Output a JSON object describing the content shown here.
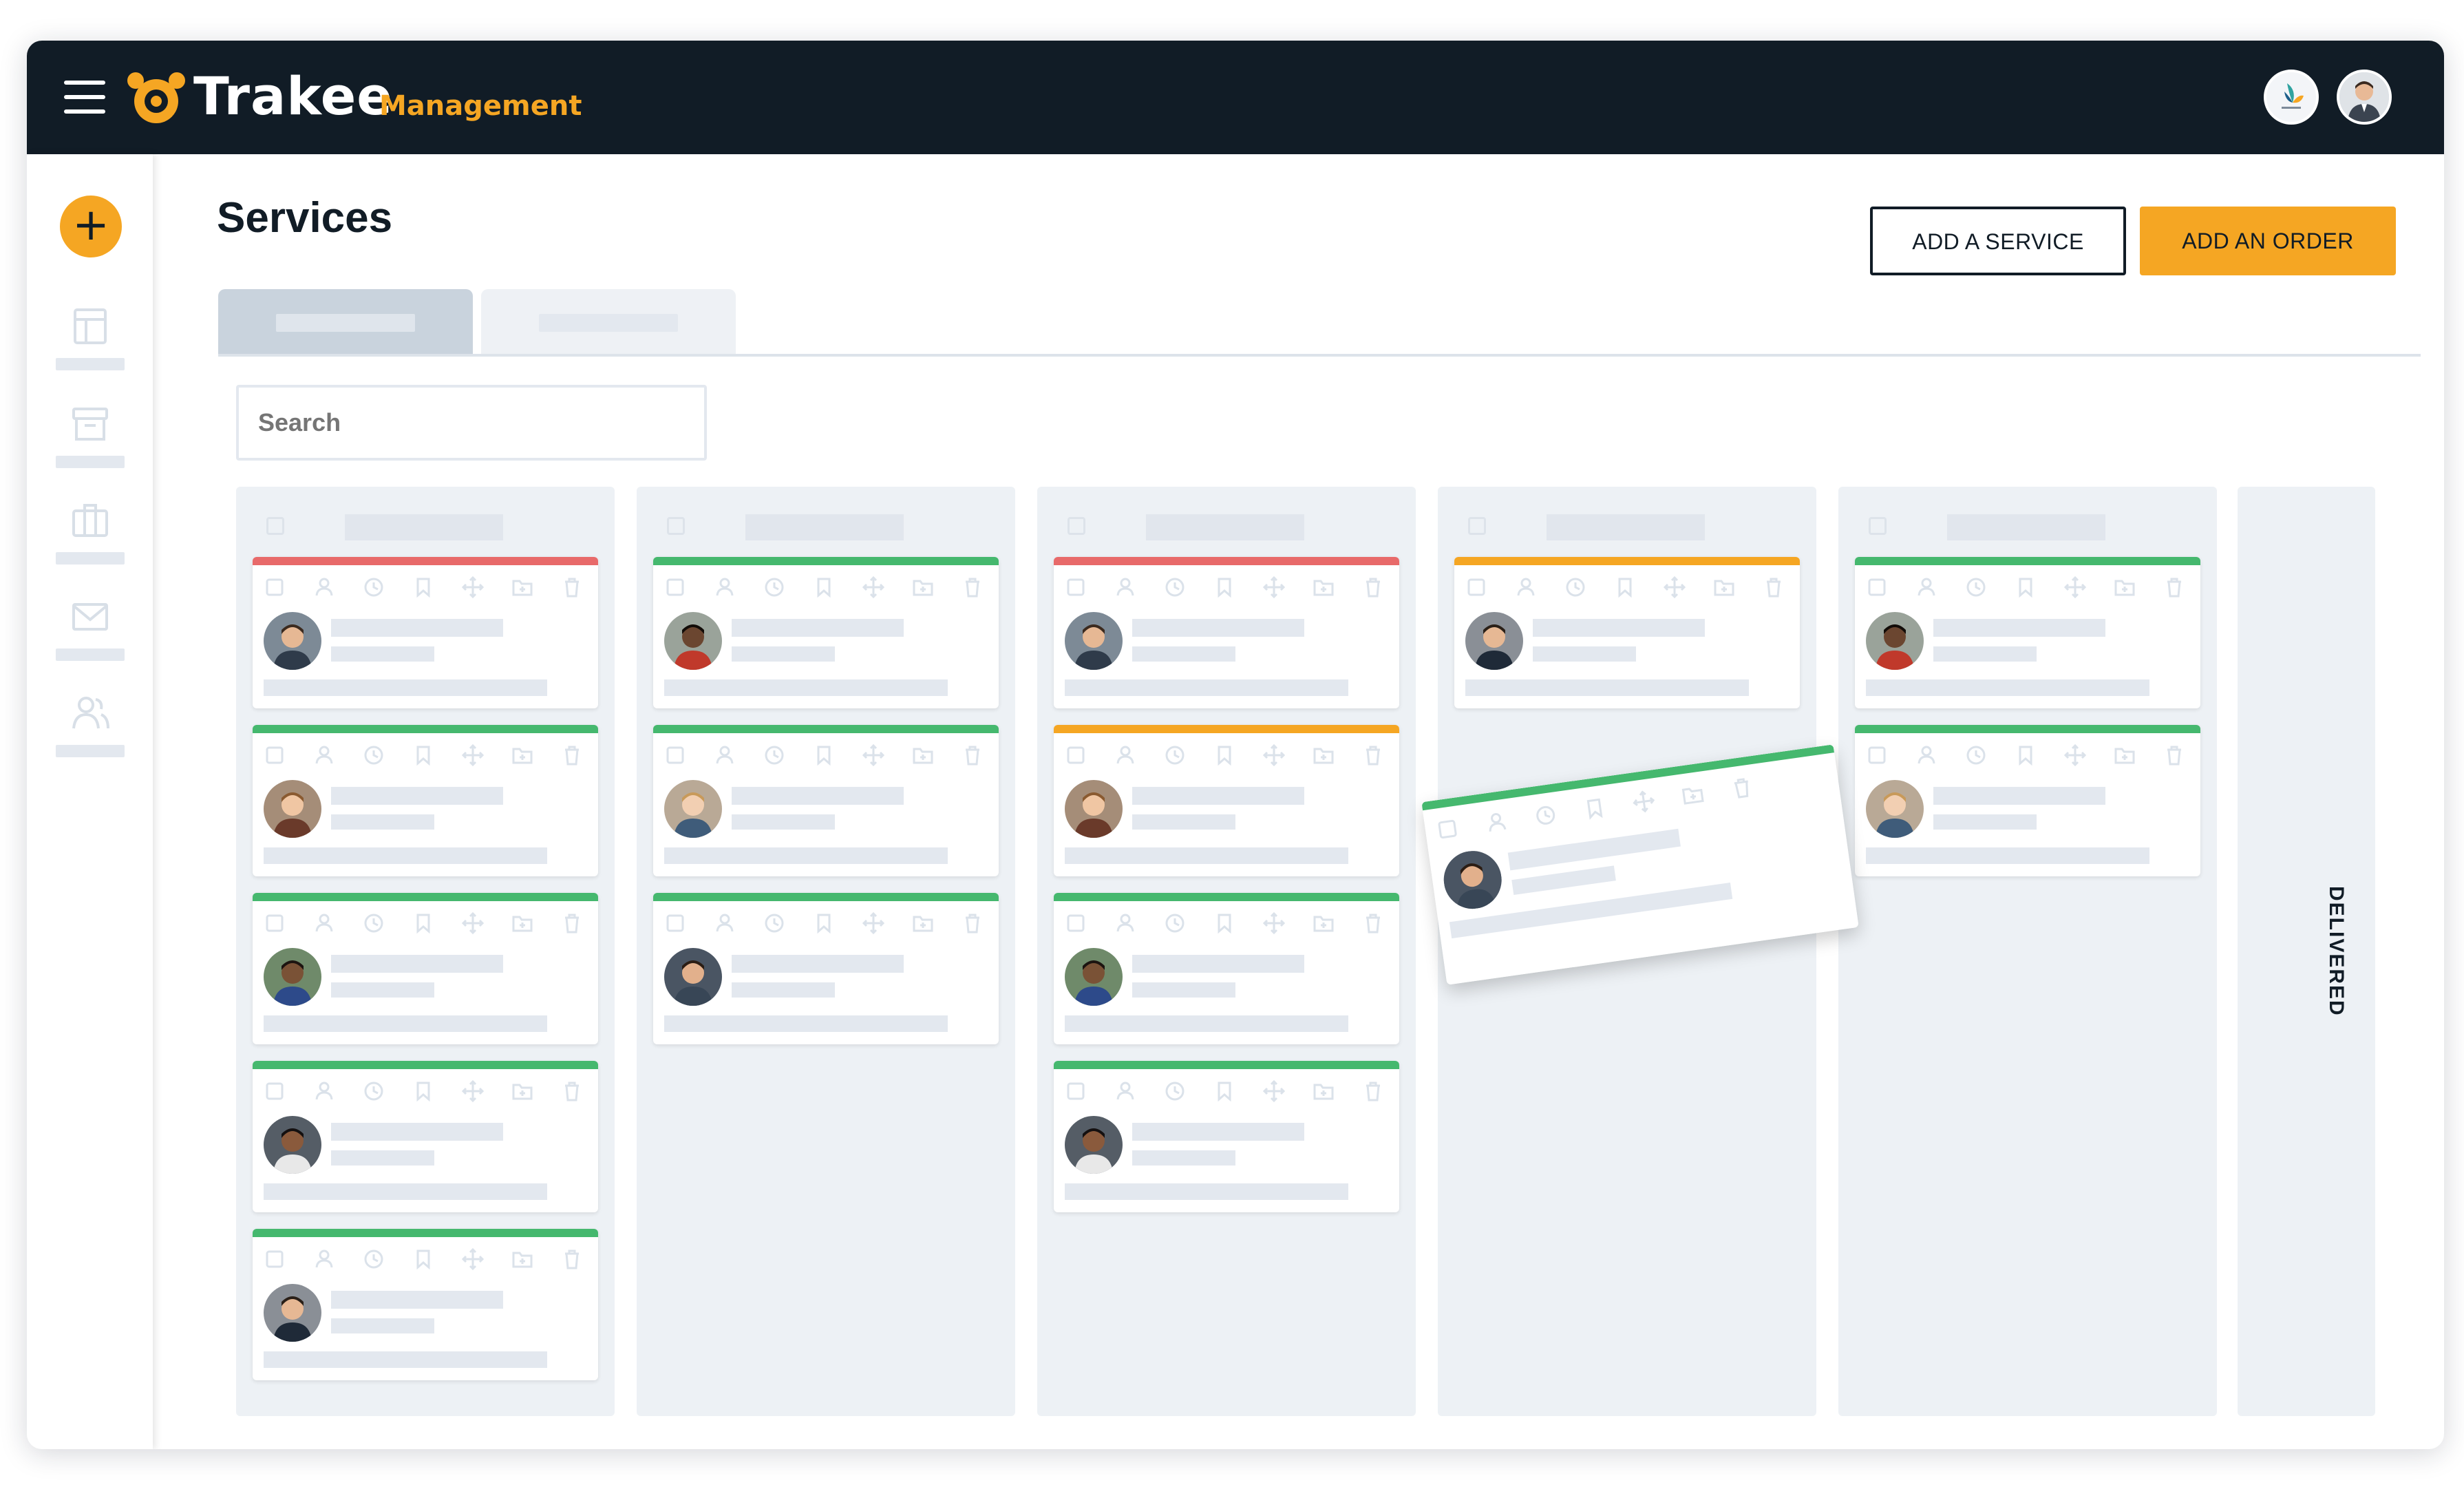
{
  "app": {
    "brand_name": "Trakee",
    "brand_sub": "Management",
    "colors": {
      "topbar": "#111c26",
      "accent": "#f5a623",
      "status_red": "#e86a6a",
      "status_green": "#45b86e",
      "status_orange": "#f5a623"
    }
  },
  "header": {
    "menu_icon": "hamburger-icon",
    "org_logo": "company-logo",
    "user_avatar": "user-avatar"
  },
  "sidebar": {
    "add_icon": "plus-icon",
    "items": [
      {
        "icon": "layout-icon"
      },
      {
        "icon": "archive-icon"
      },
      {
        "icon": "briefcase-icon"
      },
      {
        "icon": "mail-icon"
      },
      {
        "icon": "users-icon"
      }
    ]
  },
  "page": {
    "title": "Services",
    "add_service_label": "ADD A SERVICE",
    "add_order_label": "ADD AN ORDER",
    "search_placeholder": "Search"
  },
  "board": {
    "card_icons": [
      "checkbox-icon",
      "person-icon",
      "clock-icon",
      "bookmark-icon",
      "move-icon",
      "folder-icon",
      "trash-icon"
    ],
    "columns": [
      {
        "cards": [
          {
            "status": "red"
          },
          {
            "status": "green"
          },
          {
            "status": "green"
          },
          {
            "status": "green"
          },
          {
            "status": "green"
          }
        ]
      },
      {
        "cards": [
          {
            "status": "green"
          },
          {
            "status": "green"
          },
          {
            "status": "green"
          }
        ]
      },
      {
        "cards": [
          {
            "status": "red"
          },
          {
            "status": "orange"
          },
          {
            "status": "green"
          },
          {
            "status": "green"
          }
        ]
      },
      {
        "cards": [
          {
            "status": "orange"
          }
        ]
      },
      {
        "cards": [
          {
            "status": "green"
          },
          {
            "status": "green"
          }
        ]
      }
    ],
    "dragging_card": {
      "status": "green"
    },
    "collapsed_column_label": "DELIVERED"
  }
}
